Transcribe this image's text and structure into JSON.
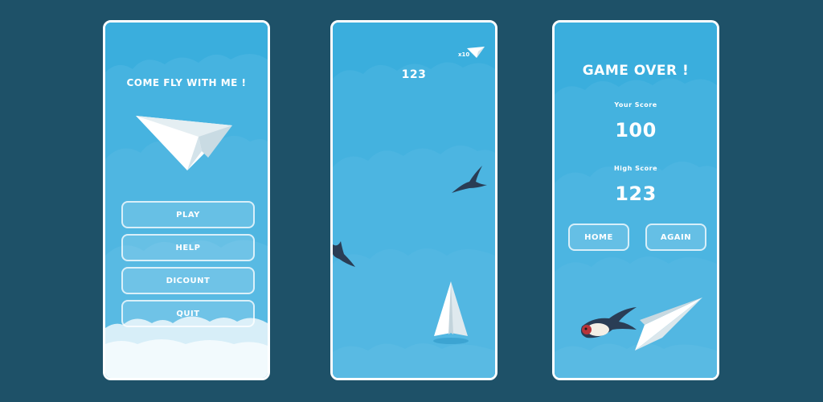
{
  "colors": {
    "background": "#1e5168",
    "sky": "#3aaedd",
    "cloud": "#56b8e2",
    "frame": "#ffffff"
  },
  "menu_screen": {
    "title": "COME FLY WITH ME !",
    "buttons": [
      "PLAY",
      "HELP",
      "DICOUNT",
      "QUIT"
    ]
  },
  "play_screen": {
    "score": "123",
    "multiplier": "x10",
    "icons": [
      "paper-plane-icon",
      "swallow-bird-icon"
    ]
  },
  "game_over_screen": {
    "title": "GAME OVER !",
    "your_score_label": "Your Score",
    "your_score": "100",
    "high_score_label": "High Score",
    "high_score": "123",
    "home_label": "HOME",
    "again_label": "AGAIN"
  }
}
